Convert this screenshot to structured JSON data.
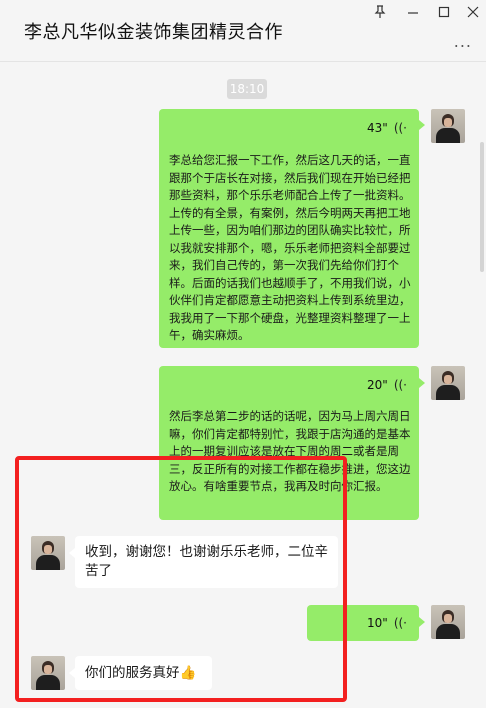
{
  "window": {
    "title": "李总凡华似金装饰集团精灵合作",
    "pin_icon": "pin-icon",
    "min_icon": "minimize-icon",
    "max_icon": "maximize-icon",
    "close_icon": "close-icon",
    "more_label": "..."
  },
  "chat": {
    "timestamp": "18:10",
    "messages": [
      {
        "side": "right",
        "type": "voice",
        "duration": "43\"",
        "transcript": "李总给您汇报一下工作，然后这几天的话，一直跟那个于店长在对接，然后我们现在开始已经把那些资料，那个乐乐老师配合上传了一批资料。上传的有全景，有案例，然后今明两天再把工地上传一些，因为咱们那边的团队确实比较忙，所以我就安排那个，嗯，乐乐老师把资料全部要过来，我们自己传的，第一次我们先给你们打个样。后面的话我们也越顺手了，不用我们说，小伙伴们肯定都愿意主动把资料上传到系统里边，我我用了一下那个硬盘，光整理资料整理了一上午，确实麻烦。"
      },
      {
        "side": "right",
        "type": "voice",
        "duration": "20\"",
        "transcript": "然后李总第二步的话的话呢，因为马上周六周日嘛，你们肯定都特别忙，我跟于店沟通的是基本上的一期复训应该是放在下周的周二或者是周三，反正所有的对接工作都在稳步推进，您这边放心。有啥重要节点，我再及时向你汇报。"
      },
      {
        "side": "left",
        "type": "text",
        "text": "收到，谢谢您！也谢谢乐乐老师，二位辛苦了"
      },
      {
        "side": "right",
        "type": "voice",
        "duration": "10\""
      },
      {
        "side": "left",
        "type": "text",
        "text": "你们的服务真好👍"
      }
    ]
  },
  "colors": {
    "sent_bubble": "#95ec69",
    "received_bubble": "#ffffff",
    "highlight": "#f32020",
    "background": "#f5f5f5"
  }
}
